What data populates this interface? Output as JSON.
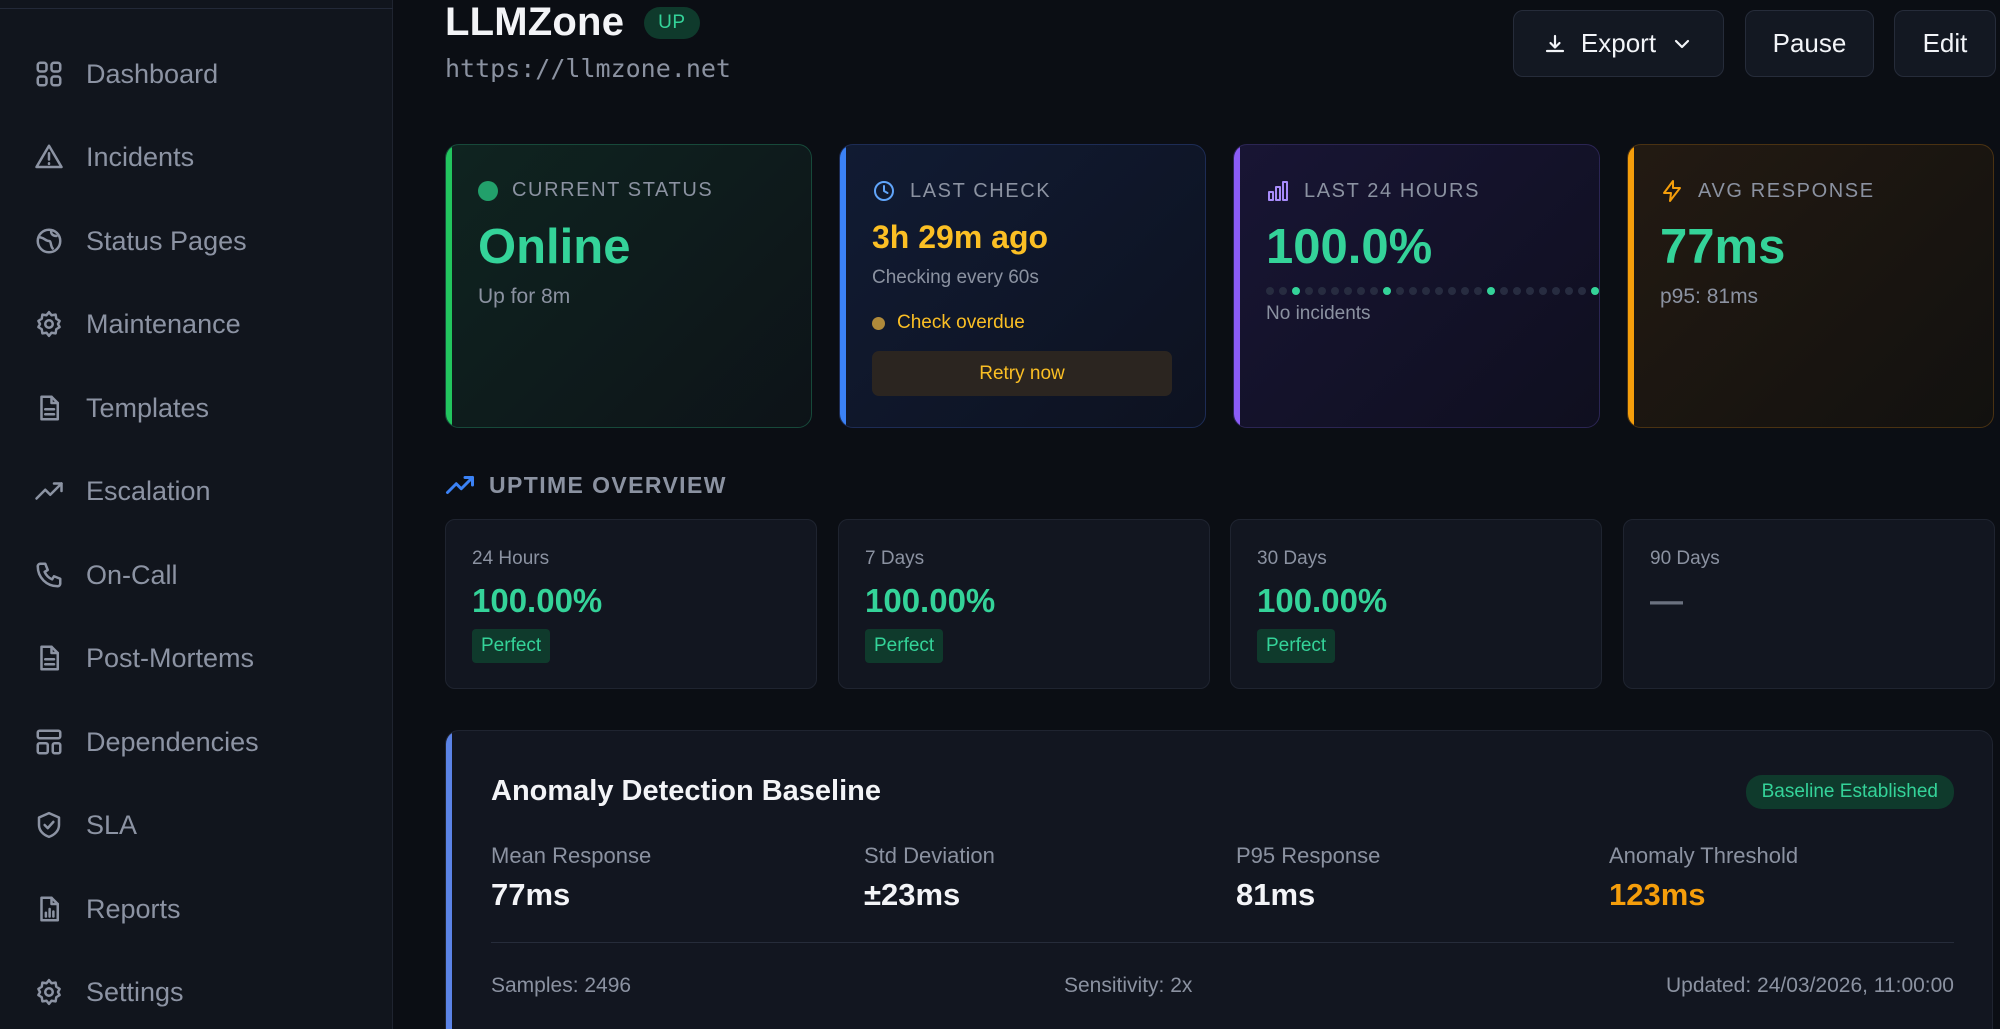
{
  "sidebar": {
    "items": [
      {
        "label": "Dashboard",
        "icon": "grid-icon"
      },
      {
        "label": "Incidents",
        "icon": "alert-triangle-icon"
      },
      {
        "label": "Status Pages",
        "icon": "globe-icon"
      },
      {
        "label": "Maintenance",
        "icon": "gear-icon"
      },
      {
        "label": "Templates",
        "icon": "file-icon"
      },
      {
        "label": "Escalation",
        "icon": "trending-up-icon"
      },
      {
        "label": "On-Call",
        "icon": "phone-icon"
      },
      {
        "label": "Post-Mortems",
        "icon": "file-icon"
      },
      {
        "label": "Dependencies",
        "icon": "layout-icon"
      },
      {
        "label": "SLA",
        "icon": "shield-check-icon"
      },
      {
        "label": "Reports",
        "icon": "file-chart-icon"
      },
      {
        "label": "Settings",
        "icon": "gear-icon"
      }
    ]
  },
  "header": {
    "title": "LLMZone",
    "status_badge": "UP",
    "url": "https://llmzone.net",
    "export_label": "Export",
    "pause_label": "Pause",
    "edit_label": "Edit"
  },
  "stats": {
    "current_status": {
      "label": "CURRENT STATUS",
      "value": "Online",
      "sub": "Up for 8m",
      "color": "#34d399"
    },
    "last_check": {
      "label": "LAST CHECK",
      "value": "3h 29m ago",
      "sub": "Checking every 60s",
      "warning": "Check overdue",
      "retry_label": "Retry now",
      "color": "#fbbf24"
    },
    "last_24h": {
      "label": "LAST 24 HOURS",
      "value": "100.0%",
      "sub": "No incidents",
      "color": "#34d399"
    },
    "avg_response": {
      "label": "AVG RESPONSE",
      "value": "77ms",
      "sub": "p95: 81ms",
      "color": "#34d399"
    }
  },
  "uptime_overview": {
    "title": "UPTIME OVERVIEW",
    "cards": [
      {
        "label": "24 Hours",
        "value": "100.00%",
        "pill": "Perfect"
      },
      {
        "label": "7 Days",
        "value": "100.00%",
        "pill": "Perfect"
      },
      {
        "label": "30 Days",
        "value": "100.00%",
        "pill": "Perfect"
      },
      {
        "label": "90 Days",
        "value": "—",
        "pill": ""
      }
    ]
  },
  "baseline": {
    "title": "Anomaly Detection Baseline",
    "badge": "Baseline Established",
    "metrics": [
      {
        "label": "Mean Response",
        "value": "77ms"
      },
      {
        "label": "Std Deviation",
        "value": "±23ms"
      },
      {
        "label": "P95 Response",
        "value": "81ms"
      },
      {
        "label": "Anomaly Threshold",
        "value": "123ms",
        "color": "#f59e0b"
      }
    ],
    "samples": "Samples: 2496",
    "sensitivity": "Sensitivity: 2x",
    "updated": "Updated: 24/03/2026, 11:00:00"
  }
}
